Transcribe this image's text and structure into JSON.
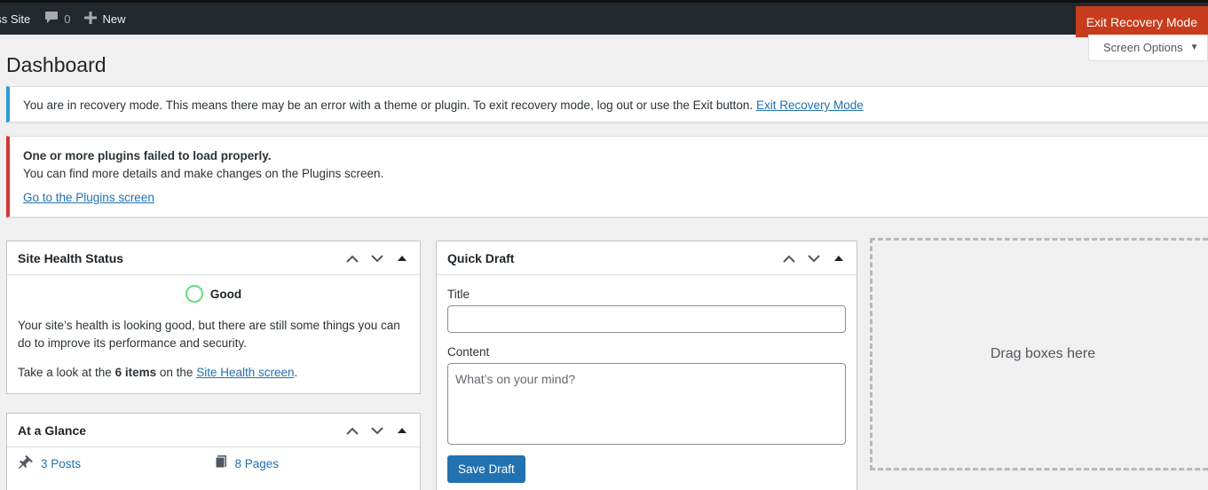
{
  "adminbar": {
    "site_name": "ess Site",
    "comments_count": "0",
    "new_label": "New",
    "exit_label": "Exit Recovery Mode"
  },
  "screen_options": {
    "label": "Screen Options",
    "arrow": "▼"
  },
  "page_title": "Dashboard",
  "notice_info": {
    "text": "You are in recovery mode. This means there may be an error with a theme or plugin. To exit recovery mode, log out or use the Exit button.",
    "link": "Exit Recovery Mode"
  },
  "notice_error": {
    "heading": "One or more plugins failed to load properly.",
    "text": "You can find more details and make changes on the Plugins screen.",
    "link": "Go to the Plugins screen"
  },
  "site_health": {
    "title": "Site Health Status",
    "status": "Good",
    "description": "Your site’s health is looking good, but there are still some things you can do to improve its performance and security.",
    "look_prefix": "Take a look at the",
    "items_count": "6 items",
    "look_mid": "on the",
    "link": "Site Health screen",
    "look_suffix": "."
  },
  "at_a_glance": {
    "title": "At a Glance",
    "posts": "3 Posts",
    "pages": "8 Pages"
  },
  "quick_draft": {
    "title": "Quick Draft",
    "title_label": "Title",
    "title_value": "",
    "content_label": "Content",
    "content_placeholder": "What’s on your mind?",
    "save_label": "Save Draft"
  },
  "dropzone": {
    "label": "Drag boxes here"
  },
  "colors": {
    "adminbar": "#23282d",
    "exit_button": "#c73c1c",
    "info_border": "#2a9cd3",
    "error_border": "#d63638",
    "link": "#2271b1",
    "good_ring": "#68de7c"
  },
  "icons": {
    "comments": "speech-bubble-icon",
    "new": "plus-icon",
    "posts": "pushpin-icon",
    "pages": "pages-icon"
  }
}
